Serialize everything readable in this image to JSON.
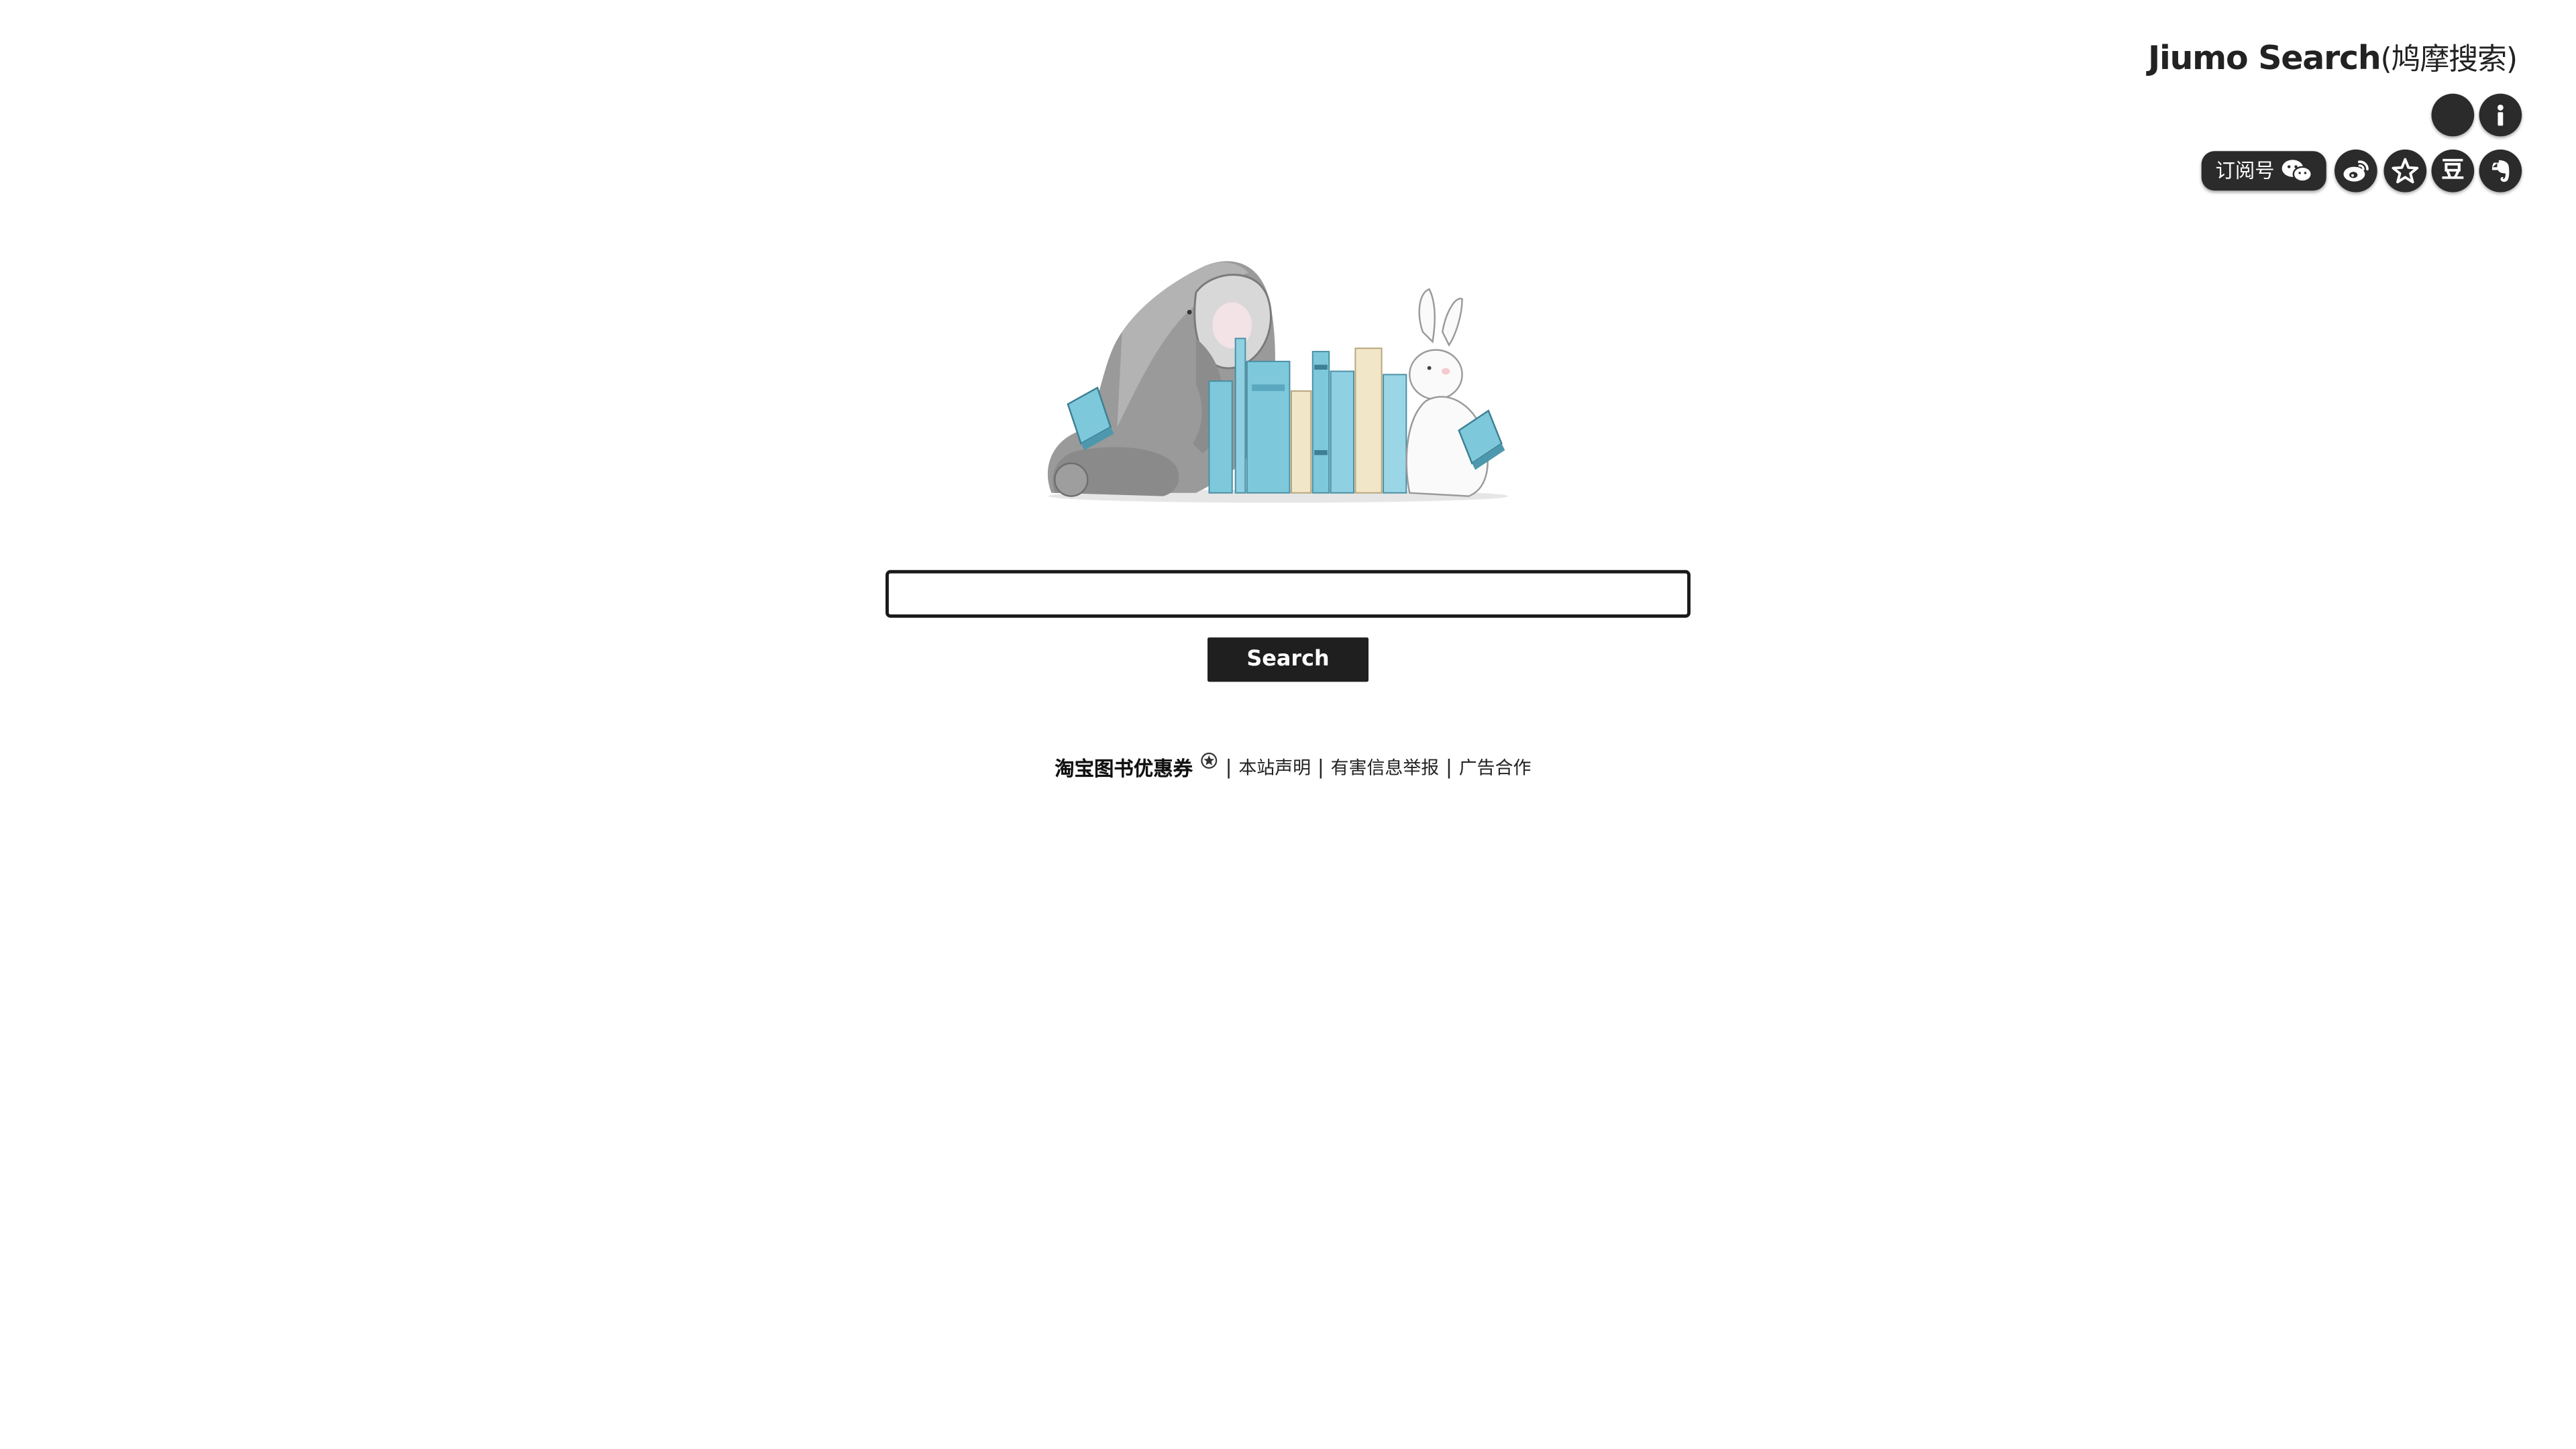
{
  "brand": {
    "title": "Jiumo Search",
    "subtitle": "(鸠摩搜索)"
  },
  "toolbar": {
    "theme_toggle_icon": "moon-icon",
    "about_icon": "info-icon",
    "subscribe_label": "订阅号",
    "subscribe_icon": "wechat-icon",
    "social": [
      {
        "name": "weibo",
        "icon": "weibo-icon"
      },
      {
        "name": "favorite",
        "icon": "star-icon"
      },
      {
        "name": "douban",
        "icon": "douban-icon",
        "glyph": "豆"
      },
      {
        "name": "evernote",
        "icon": "evernote-icon"
      }
    ]
  },
  "search": {
    "placeholder": "",
    "value": "",
    "button_label": "Search"
  },
  "footer": {
    "coupon_label": "淘宝图书优惠券",
    "separator": "|",
    "links": [
      "本站声明",
      "有害信息举报",
      "广告合作"
    ]
  },
  "colors": {
    "button_bg": "#1f1f1f",
    "book_blue": "#7ec8dc",
    "book_cream": "#f1e6c8"
  }
}
